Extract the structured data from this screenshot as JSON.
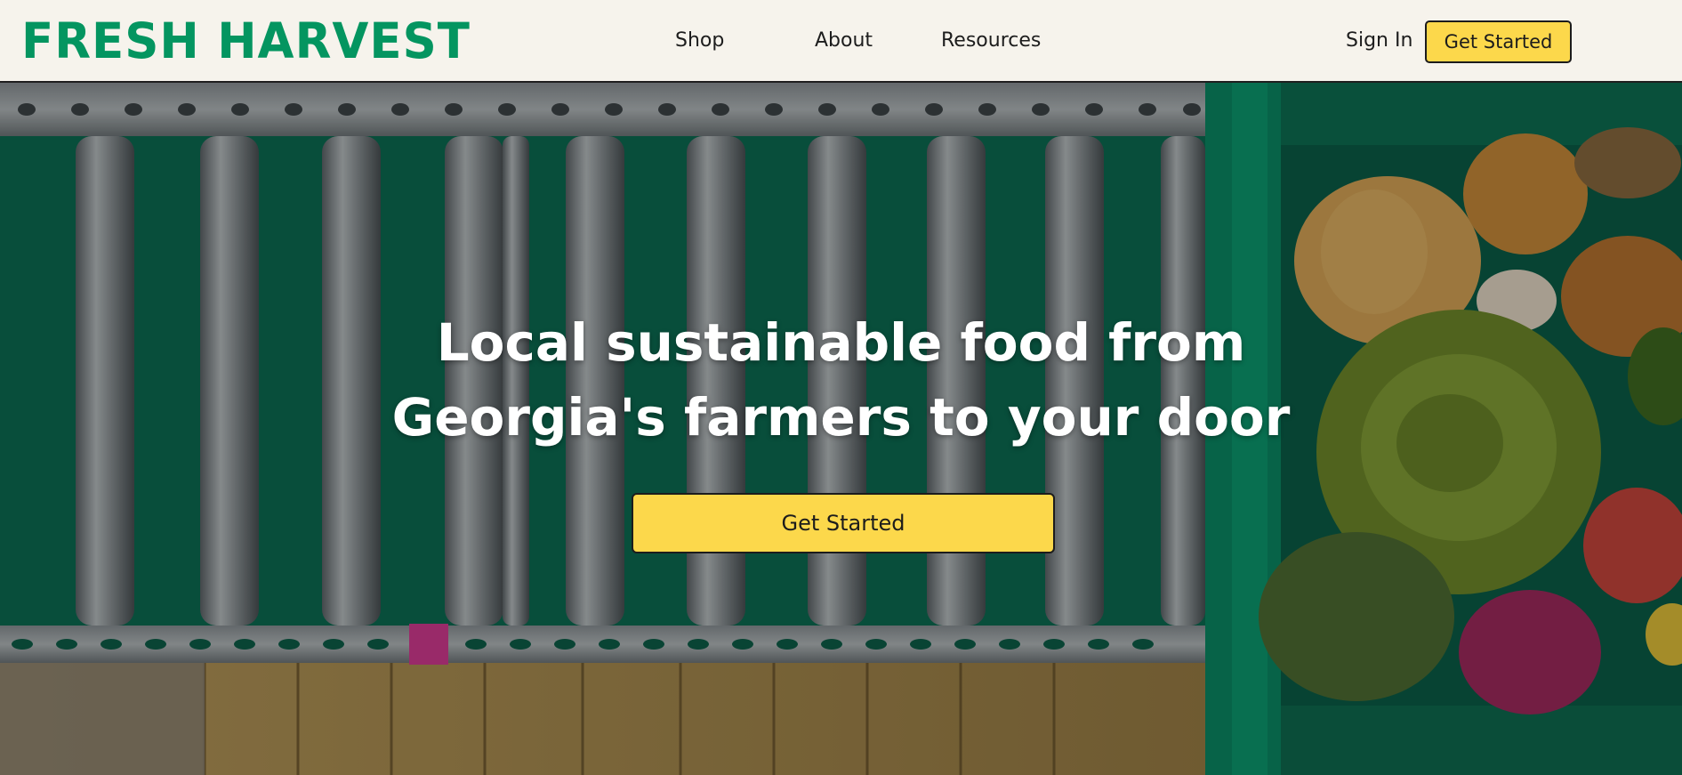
{
  "brand": {
    "name": "FRESH HARVEST",
    "color": "#049560"
  },
  "nav": {
    "links": [
      {
        "label": "Shop"
      },
      {
        "label": "About"
      },
      {
        "label": "Resources"
      }
    ],
    "sign_in": "Sign In",
    "cta": "Get Started"
  },
  "hero": {
    "headline_line1": "Local sustainable food from",
    "headline_line2": "Georgia's farmers to your door",
    "cta": "Get Started",
    "accent_color": "#fcd84b",
    "image_alt": "Conveyor rollers next to a green crate of fresh produce"
  }
}
